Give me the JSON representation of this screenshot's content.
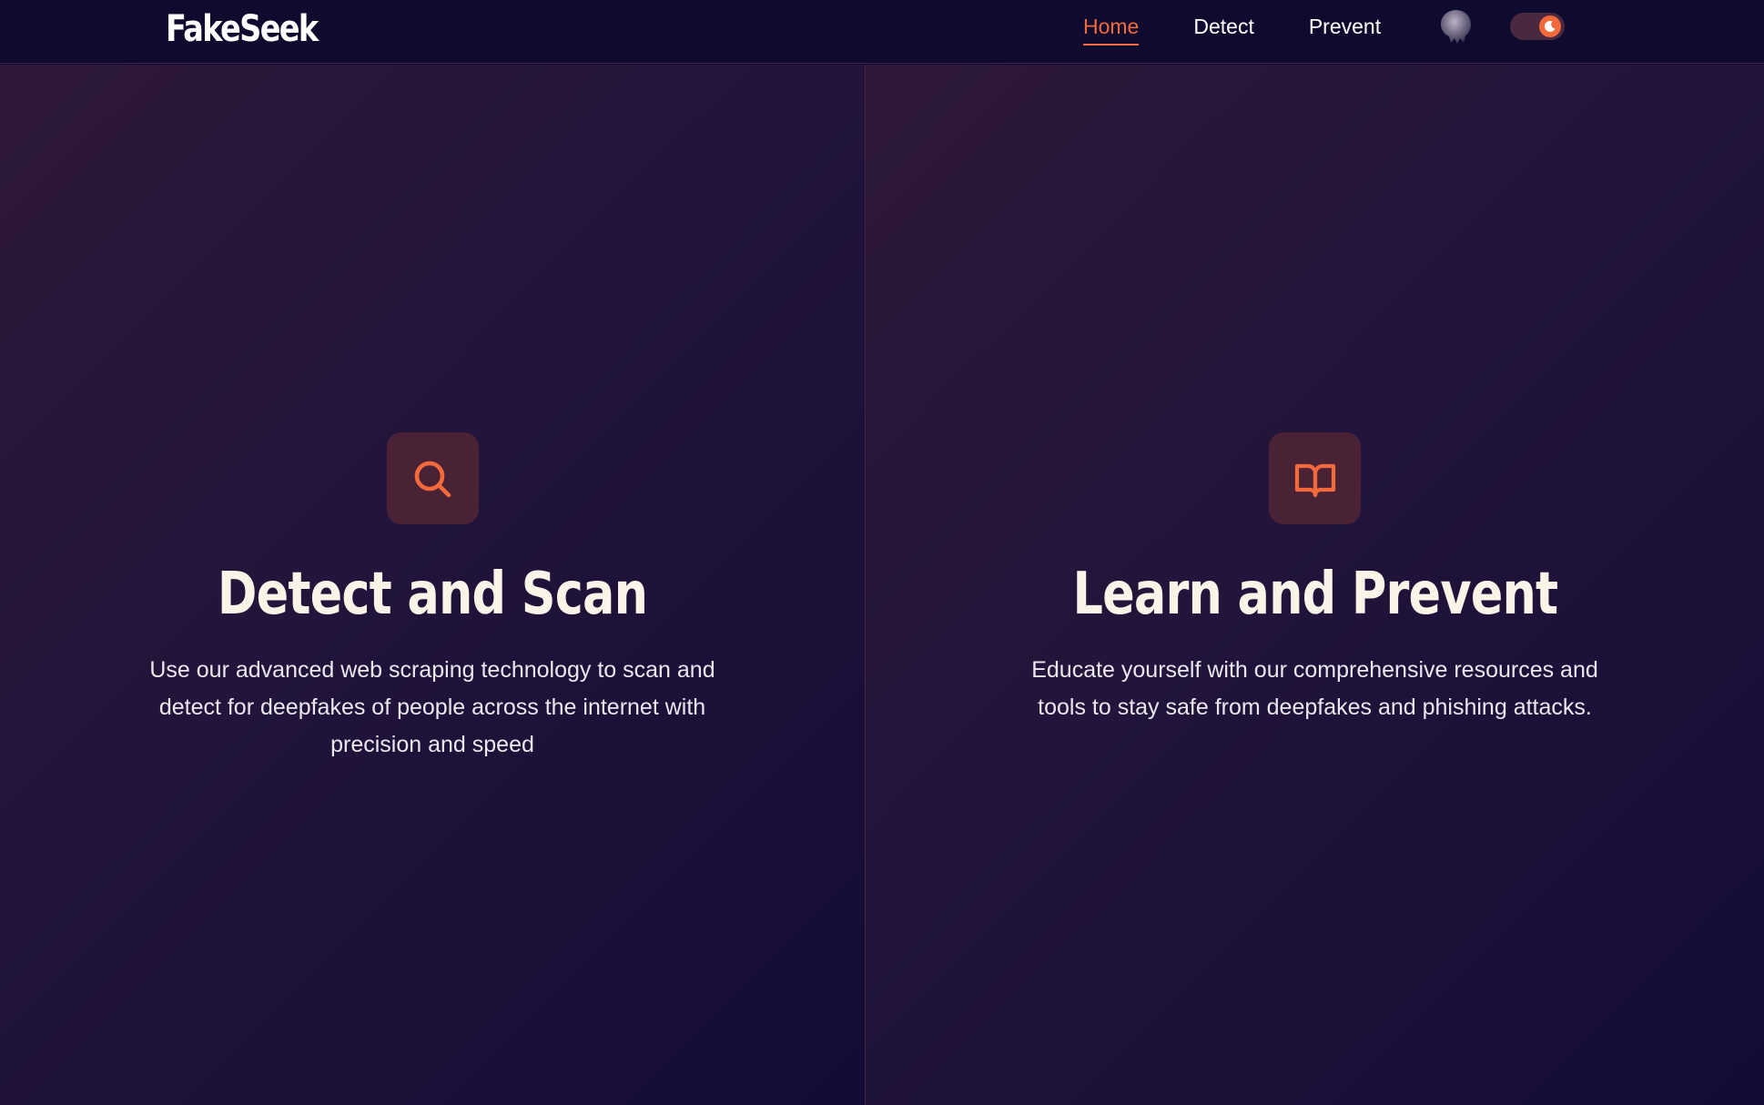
{
  "navbar": {
    "brand": "FakeSeek",
    "links": [
      {
        "label": "Home",
        "active": true
      },
      {
        "label": "Detect",
        "active": false
      },
      {
        "label": "Prevent",
        "active": false
      }
    ],
    "avatar_icon": "user-avatar-icon",
    "theme_toggle": {
      "state": "dark",
      "icon": "moon-icon"
    }
  },
  "panels": {
    "detect": {
      "icon": "search-icon",
      "title": "Detect and Scan",
      "description": "Use our advanced web scraping technology to scan and detect for deepfakes of people across the internet with precision and speed"
    },
    "prevent": {
      "icon": "book-open-icon",
      "title": "Learn and Prevent",
      "description": "Educate yourself with our comprehensive resources and tools to stay safe from deepfakes and phishing attacks."
    }
  },
  "colors": {
    "accent": "#f26a3c",
    "nav_bg": "#0e0b2e",
    "icon_box_bg": "#4a2236",
    "title_text": "#fbf3e8"
  }
}
